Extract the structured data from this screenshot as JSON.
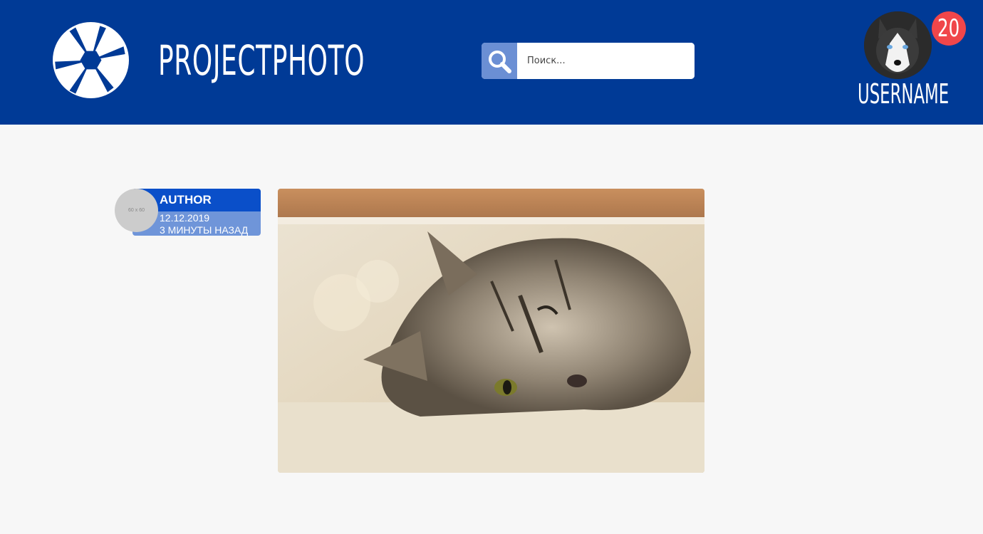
{
  "header": {
    "brand": "PROJECTPHOTO",
    "logo_icon": "camera-aperture-icon",
    "background": "#003a96"
  },
  "search": {
    "placeholder": "Поиск...",
    "value": "",
    "icon": "search-icon"
  },
  "user": {
    "username": "USERNAME",
    "notification_count": "20",
    "badge_color": "#f0464a"
  },
  "post": {
    "author": {
      "name": "AUTHOR",
      "date": "12.12.2019",
      "time_ago": "3 МИНУТЫ НАЗАД",
      "avatar_placeholder": "60 x 60"
    },
    "photo_description": "cat-photo"
  }
}
